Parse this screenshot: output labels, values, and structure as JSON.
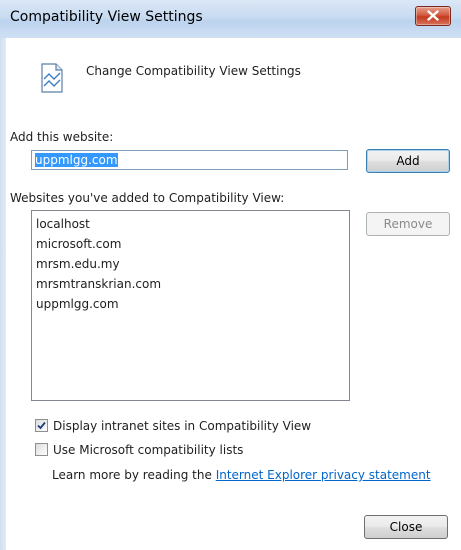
{
  "window": {
    "title": "Compatibility View Settings"
  },
  "header": {
    "text": "Change Compatibility View Settings",
    "icon": "compat-view-icon"
  },
  "add_section": {
    "label": "Add this website:",
    "input_value": "uppmlgg.com",
    "add_label": "Add"
  },
  "list_section": {
    "label": "Websites you've added to Compatibility View:",
    "items": [
      "localhost",
      "microsoft.com",
      "mrsm.edu.my",
      "mrsmtranskrian.com",
      "uppmlgg.com"
    ],
    "remove_label": "Remove"
  },
  "options": {
    "intranet_label": "Display intranet sites in Compatibility View",
    "intranet_checked": true,
    "mslists_label": "Use Microsoft compatibility lists",
    "mslists_checked": false
  },
  "privacy": {
    "prefix": "Learn more by reading the ",
    "link_text": "Internet Explorer privacy statement"
  },
  "footer": {
    "close_label": "Close"
  },
  "colors": {
    "link": "#0066cc",
    "selection": "#3399ff",
    "close_button_red": "#c23a1f"
  }
}
